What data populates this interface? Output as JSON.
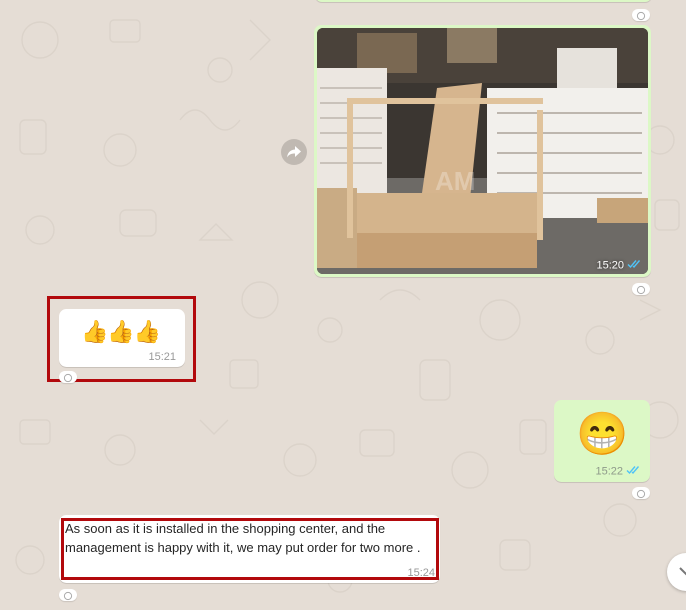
{
  "chat": {
    "messages": [
      {
        "id": "photo",
        "direction": "outgoing",
        "type": "image",
        "time": "15:20",
        "status": "read",
        "watermark": "AM"
      },
      {
        "id": "thumbs",
        "direction": "incoming",
        "type": "emoji",
        "emoji": "👍👍👍",
        "time": "15:21"
      },
      {
        "id": "grin",
        "direction": "outgoing",
        "type": "emoji",
        "emoji": "😁",
        "time": "15:22",
        "status": "read"
      },
      {
        "id": "text",
        "direction": "incoming",
        "type": "text",
        "text": "As soon as it is installed in the shopping center, and the management is happy with it, we may put order for two more .",
        "time": "15:24"
      }
    ]
  },
  "colors": {
    "background": "#e5ddd5",
    "outgoing_bubble": "#dcf8c6",
    "incoming_bubble": "#ffffff",
    "highlight_box": "#b2090c",
    "read_ticks": "#4fc3f7"
  },
  "icons": {
    "forward": "forward-arrow-icon",
    "ticks": "double-check-icon",
    "reaction": "reaction-smiley-icon",
    "scroll": "chevron-down-icon"
  }
}
